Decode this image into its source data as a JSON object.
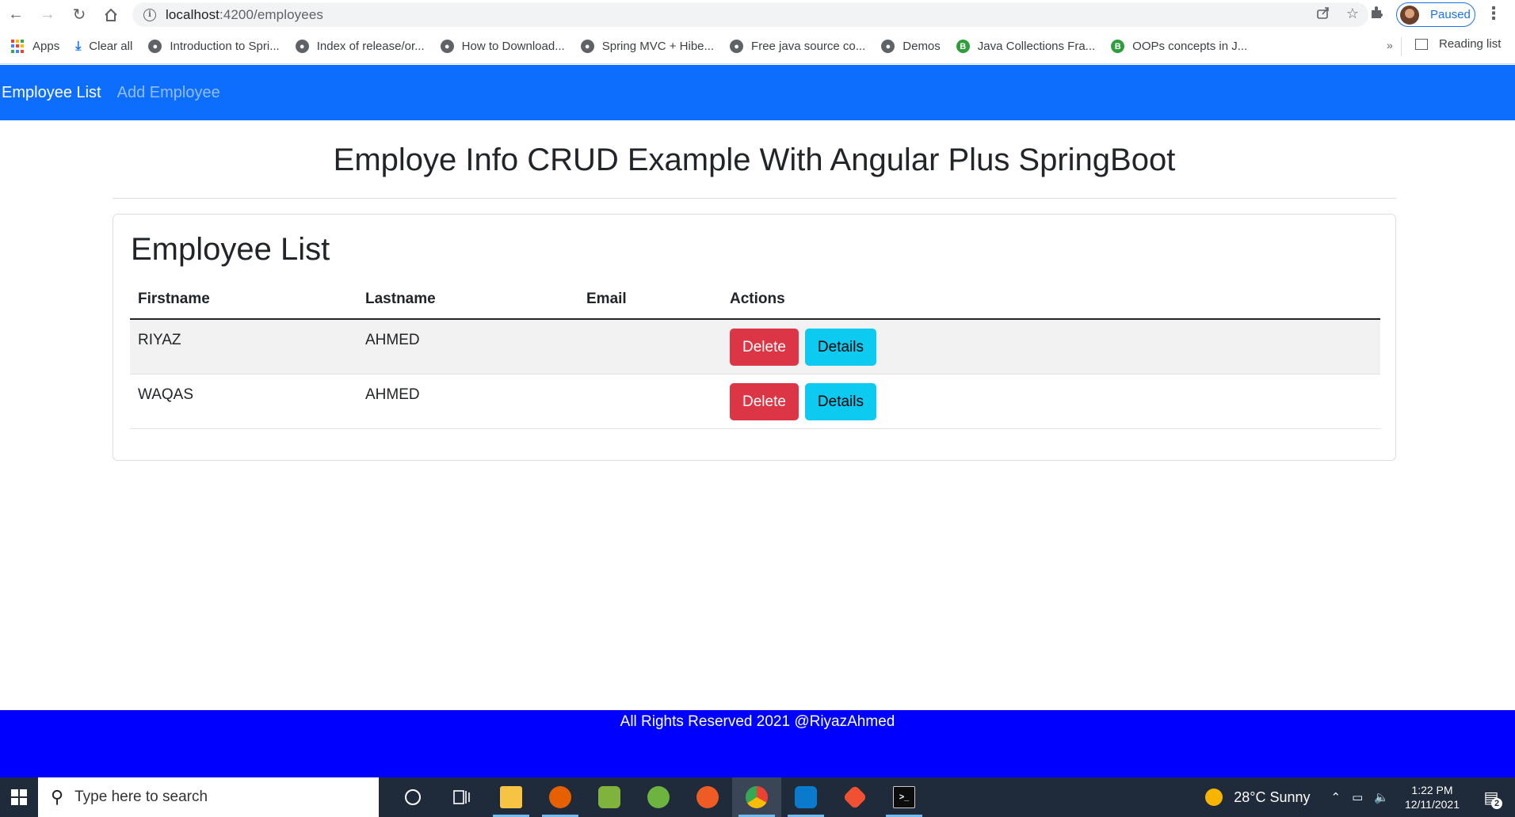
{
  "browser": {
    "url_host": "localhost",
    "url_path": ":4200/employees",
    "profile_label": "Paused",
    "bookmarks": [
      {
        "label": "Apps",
        "icon": "apps-grid-icon"
      },
      {
        "label": "Clear all",
        "icon": "download-icon"
      },
      {
        "label": "Introduction to Spri...",
        "icon": "globe-icon"
      },
      {
        "label": "Index of release/or...",
        "icon": "globe-icon"
      },
      {
        "label": "How to Download...",
        "icon": "globe-icon"
      },
      {
        "label": "Spring MVC + Hibe...",
        "icon": "globe-icon"
      },
      {
        "label": "Free java source co...",
        "icon": "globe-icon"
      },
      {
        "label": "Demos",
        "icon": "globe-icon"
      },
      {
        "label": "Java Collections Fra...",
        "icon": "b-icon"
      },
      {
        "label": "OOPs concepts in J...",
        "icon": "b-icon"
      }
    ],
    "more_bookmarks": "»",
    "reading_list": "Reading list"
  },
  "navbar": {
    "active_link": "Employee List",
    "inactive_link": "Add Employee",
    "color": "#0d6efd"
  },
  "page": {
    "title": "Employe Info CRUD Example With Angular Plus SpringBoot"
  },
  "employee_list": {
    "heading": "Employee List",
    "columns": [
      "Firstname",
      "Lastname",
      "Email",
      "Actions"
    ],
    "rows": [
      {
        "firstname": "RIYAZ",
        "lastname": "AHMED",
        "email": ""
      },
      {
        "firstname": "WAQAS",
        "lastname": "AHMED",
        "email": ""
      }
    ],
    "delete_label": "Delete",
    "details_label": "Details"
  },
  "footer": {
    "text": "All Rights Reserved 2021 @RiyazAhmed",
    "color": "#0000ff"
  },
  "taskbar": {
    "search_placeholder": "Type here to search",
    "weather": "28°C  Sunny",
    "time": "1:22 PM",
    "date": "12/11/2021",
    "notification_count": "2"
  }
}
